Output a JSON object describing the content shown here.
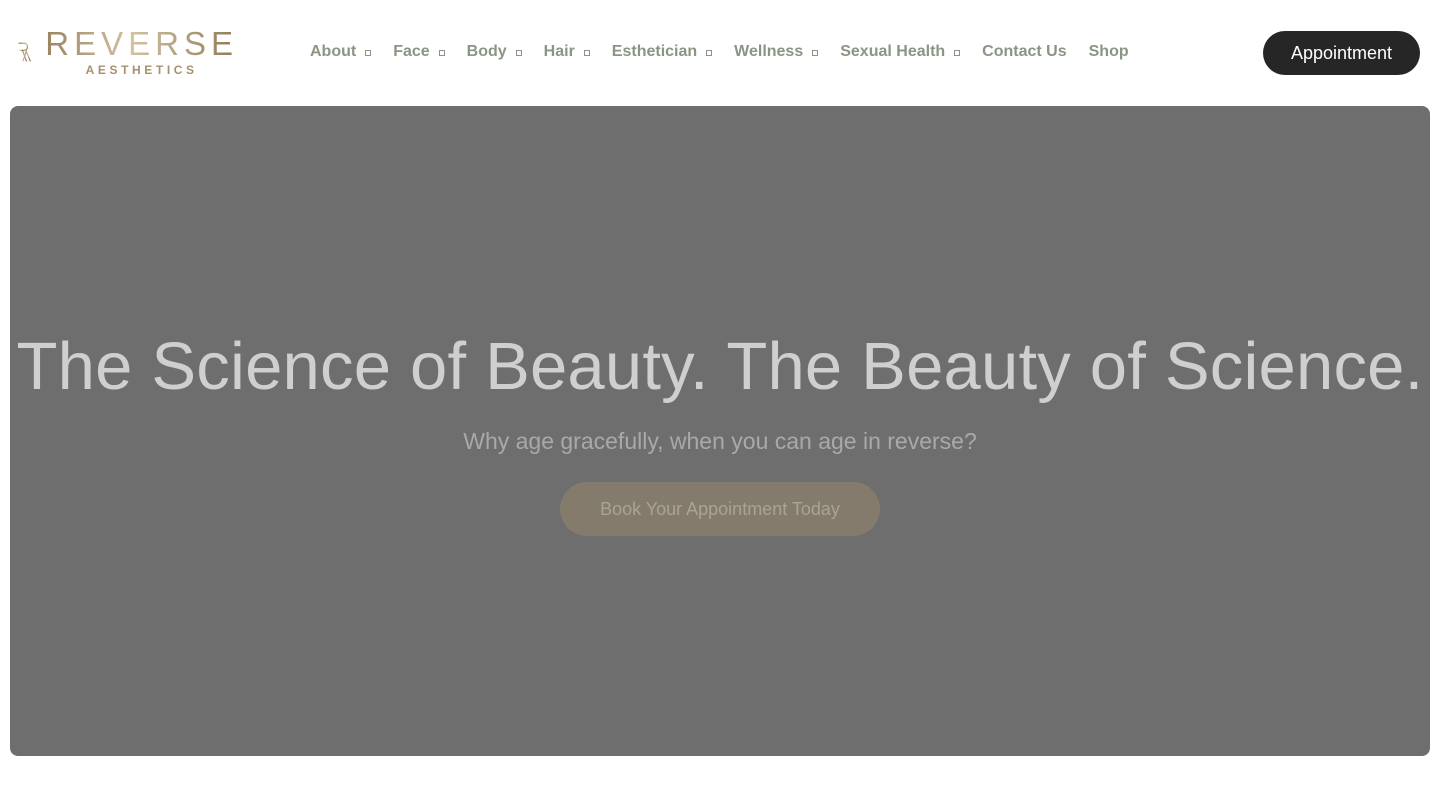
{
  "brand": {
    "name": "REVERSE",
    "tagline": "AESTHETICS",
    "colors": {
      "gold": "#b7a383",
      "nav_text": "#8a9584",
      "dark_button": "#262626",
      "hero_bg": "#6e6e6e"
    }
  },
  "nav": {
    "items": [
      {
        "label": "About",
        "has_dropdown": true
      },
      {
        "label": "Face",
        "has_dropdown": true
      },
      {
        "label": "Body",
        "has_dropdown": true
      },
      {
        "label": "Hair",
        "has_dropdown": true
      },
      {
        "label": "Esthetician",
        "has_dropdown": true
      },
      {
        "label": "Wellness",
        "has_dropdown": true
      },
      {
        "label": "Sexual Health",
        "has_dropdown": true
      },
      {
        "label": "Contact Us",
        "has_dropdown": false
      },
      {
        "label": "Shop",
        "has_dropdown": false
      }
    ],
    "appointment_label": "Appointment"
  },
  "hero": {
    "title": "The Science of Beauty. The Beauty of Science.",
    "subtitle": "Why age gracefully, when you can age in reverse?",
    "cta_label": "Book Your Appointment Today"
  }
}
